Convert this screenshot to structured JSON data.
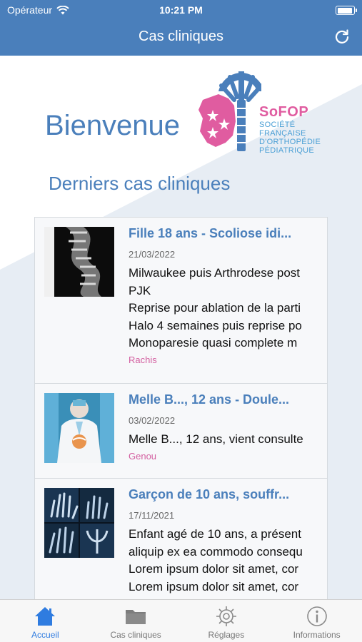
{
  "status": {
    "carrier": "Opérateur",
    "time": "10:21 PM",
    "battery_level": 0.95
  },
  "nav": {
    "title": "Cas cliniques"
  },
  "home": {
    "welcome": "Bienvenue",
    "logo": {
      "brand": "SoFOP",
      "line1": "SOCIÉTÉ",
      "line2": "FRANÇAISE",
      "line3": "D'ORTHOPÉDIE",
      "line4": "PÉDIATRIQUE"
    },
    "section_title": "Derniers cas cliniques"
  },
  "cases": [
    {
      "title": "Fille 18 ans - Scoliose idi...",
      "date": "21/03/2022",
      "lines": [
        "Milwaukee puis Arthrodese post",
        "PJK",
        "Reprise pour ablation de la parti",
        "Halo 4 semaines puis reprise po",
        "Monoparesie quasi complete m"
      ],
      "tag": "Rachis",
      "thumb_icon": "spine-xray-image"
    },
    {
      "title": "Melle B..., 12 ans - Doule...",
      "date": "03/02/2022",
      "lines": [
        "Melle B..., 12 ans, vient consulte"
      ],
      "tag": "Genou",
      "thumb_icon": "doctor-image"
    },
    {
      "title": "Garçon de 10 ans, souffr...",
      "date": "17/11/2021",
      "lines": [
        "Enfant agé de 10 ans, a présent",
        "aliquip ex ea commodo consequ",
        "Lorem ipsum dolor sit amet, cor",
        "Lorem ipsum dolor sit amet, cor"
      ],
      "tag": "",
      "thumb_icon": "hand-xray-image"
    }
  ],
  "tabs": [
    {
      "label": "Accueil",
      "icon": "home-icon",
      "active": true
    },
    {
      "label": "Cas cliniques",
      "icon": "folder-icon",
      "active": false
    },
    {
      "label": "Réglages",
      "icon": "gear-icon",
      "active": false
    },
    {
      "label": "Informations",
      "icon": "info-icon",
      "active": false
    }
  ],
  "colors": {
    "primary": "#4a7fbb",
    "accent_pink": "#d35fa0",
    "tab_active": "#2f7ce0"
  }
}
